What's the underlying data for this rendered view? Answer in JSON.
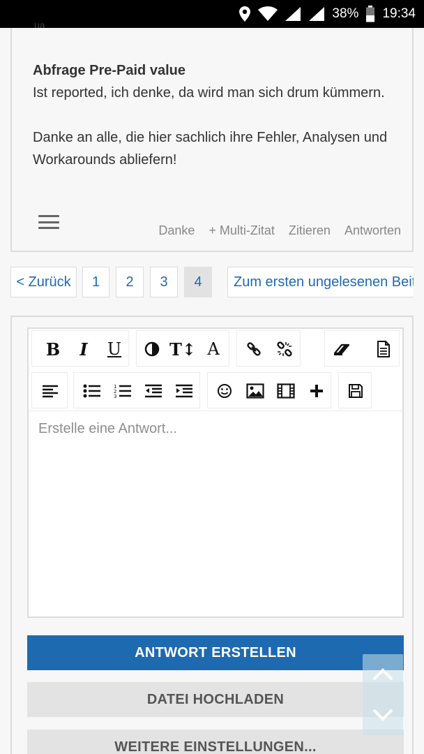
{
  "status_bar": {
    "battery": "38%",
    "time": "19:34"
  },
  "post": {
    "fragment_text": "ua",
    "heading": "Abfrage Pre-Paid value",
    "lines": [
      "Ist reported, ich denke, da wird man sich drum kümmern.",
      "Danke an alle, die hier sachlich ihre Fehler, Analysen und Workarounds abliefern!"
    ],
    "actions": {
      "thanks": "Danke",
      "multi_quote": "+ Multi-Zitat",
      "quote": "Zitieren",
      "reply": "Antworten"
    }
  },
  "pagination": {
    "back": "< Zurück",
    "pages": [
      "1",
      "2",
      "3",
      "4"
    ],
    "current_page": "4",
    "first_unread": "Zum ersten ungelesenen Beitrag"
  },
  "editor": {
    "placeholder": "Erstelle eine Antwort...",
    "toolbar_icons": [
      "bold-icon",
      "italic-icon",
      "underline-icon",
      "contrast-icon",
      "text-size-icon",
      "font-icon",
      "link-icon",
      "unlink-icon",
      "eraser-icon",
      "source-document-icon",
      "align-left-icon",
      "bullet-list-icon",
      "numbered-list-icon",
      "outdent-icon",
      "indent-icon",
      "smiley-icon",
      "image-icon",
      "video-icon",
      "plus-icon",
      "save-icon"
    ]
  },
  "buttons": {
    "submit": "ANTWORT ERSTELLEN",
    "upload": "DATEI HOCHLADEN",
    "more": "WEITERE EINSTELLUNGEN..."
  },
  "colors": {
    "accent": "#1e6ab0",
    "button_grey": "#e3e3e3",
    "border": "#dcdcdc"
  }
}
